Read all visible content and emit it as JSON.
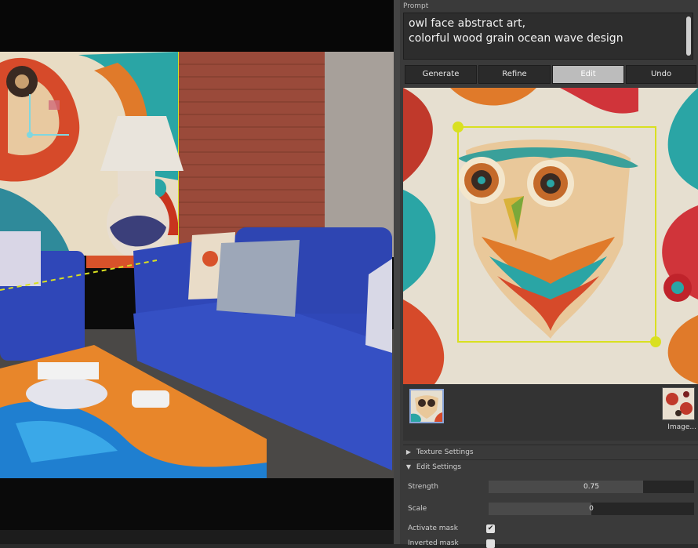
{
  "prompt": {
    "label": "Prompt",
    "text": "owl face abstract art,\ncolorful wood grain ocean wave design"
  },
  "buttons": {
    "generate": "Generate",
    "refine": "Refine",
    "edit": "Edit",
    "undo": "Undo"
  },
  "thumbnails": {
    "image_label": "Image..."
  },
  "sections": {
    "texture_settings": "Texture Settings",
    "edit_settings": "Edit Settings"
  },
  "edit_settings": {
    "strength_label": "Strength",
    "strength_value": "0.75",
    "strength_fraction": 0.75,
    "scale_label": "Scale",
    "scale_value": "0",
    "scale_fraction": 0.5,
    "activate_mask_label": "Activate mask",
    "activate_mask_checked": true,
    "inverted_mask_label": "Inverted mask",
    "inverted_mask_checked": false
  },
  "colors": {
    "accent_yellow": "#d9e021",
    "sofa_blue": "#2f47b8",
    "brick": "#9a4a3a"
  }
}
